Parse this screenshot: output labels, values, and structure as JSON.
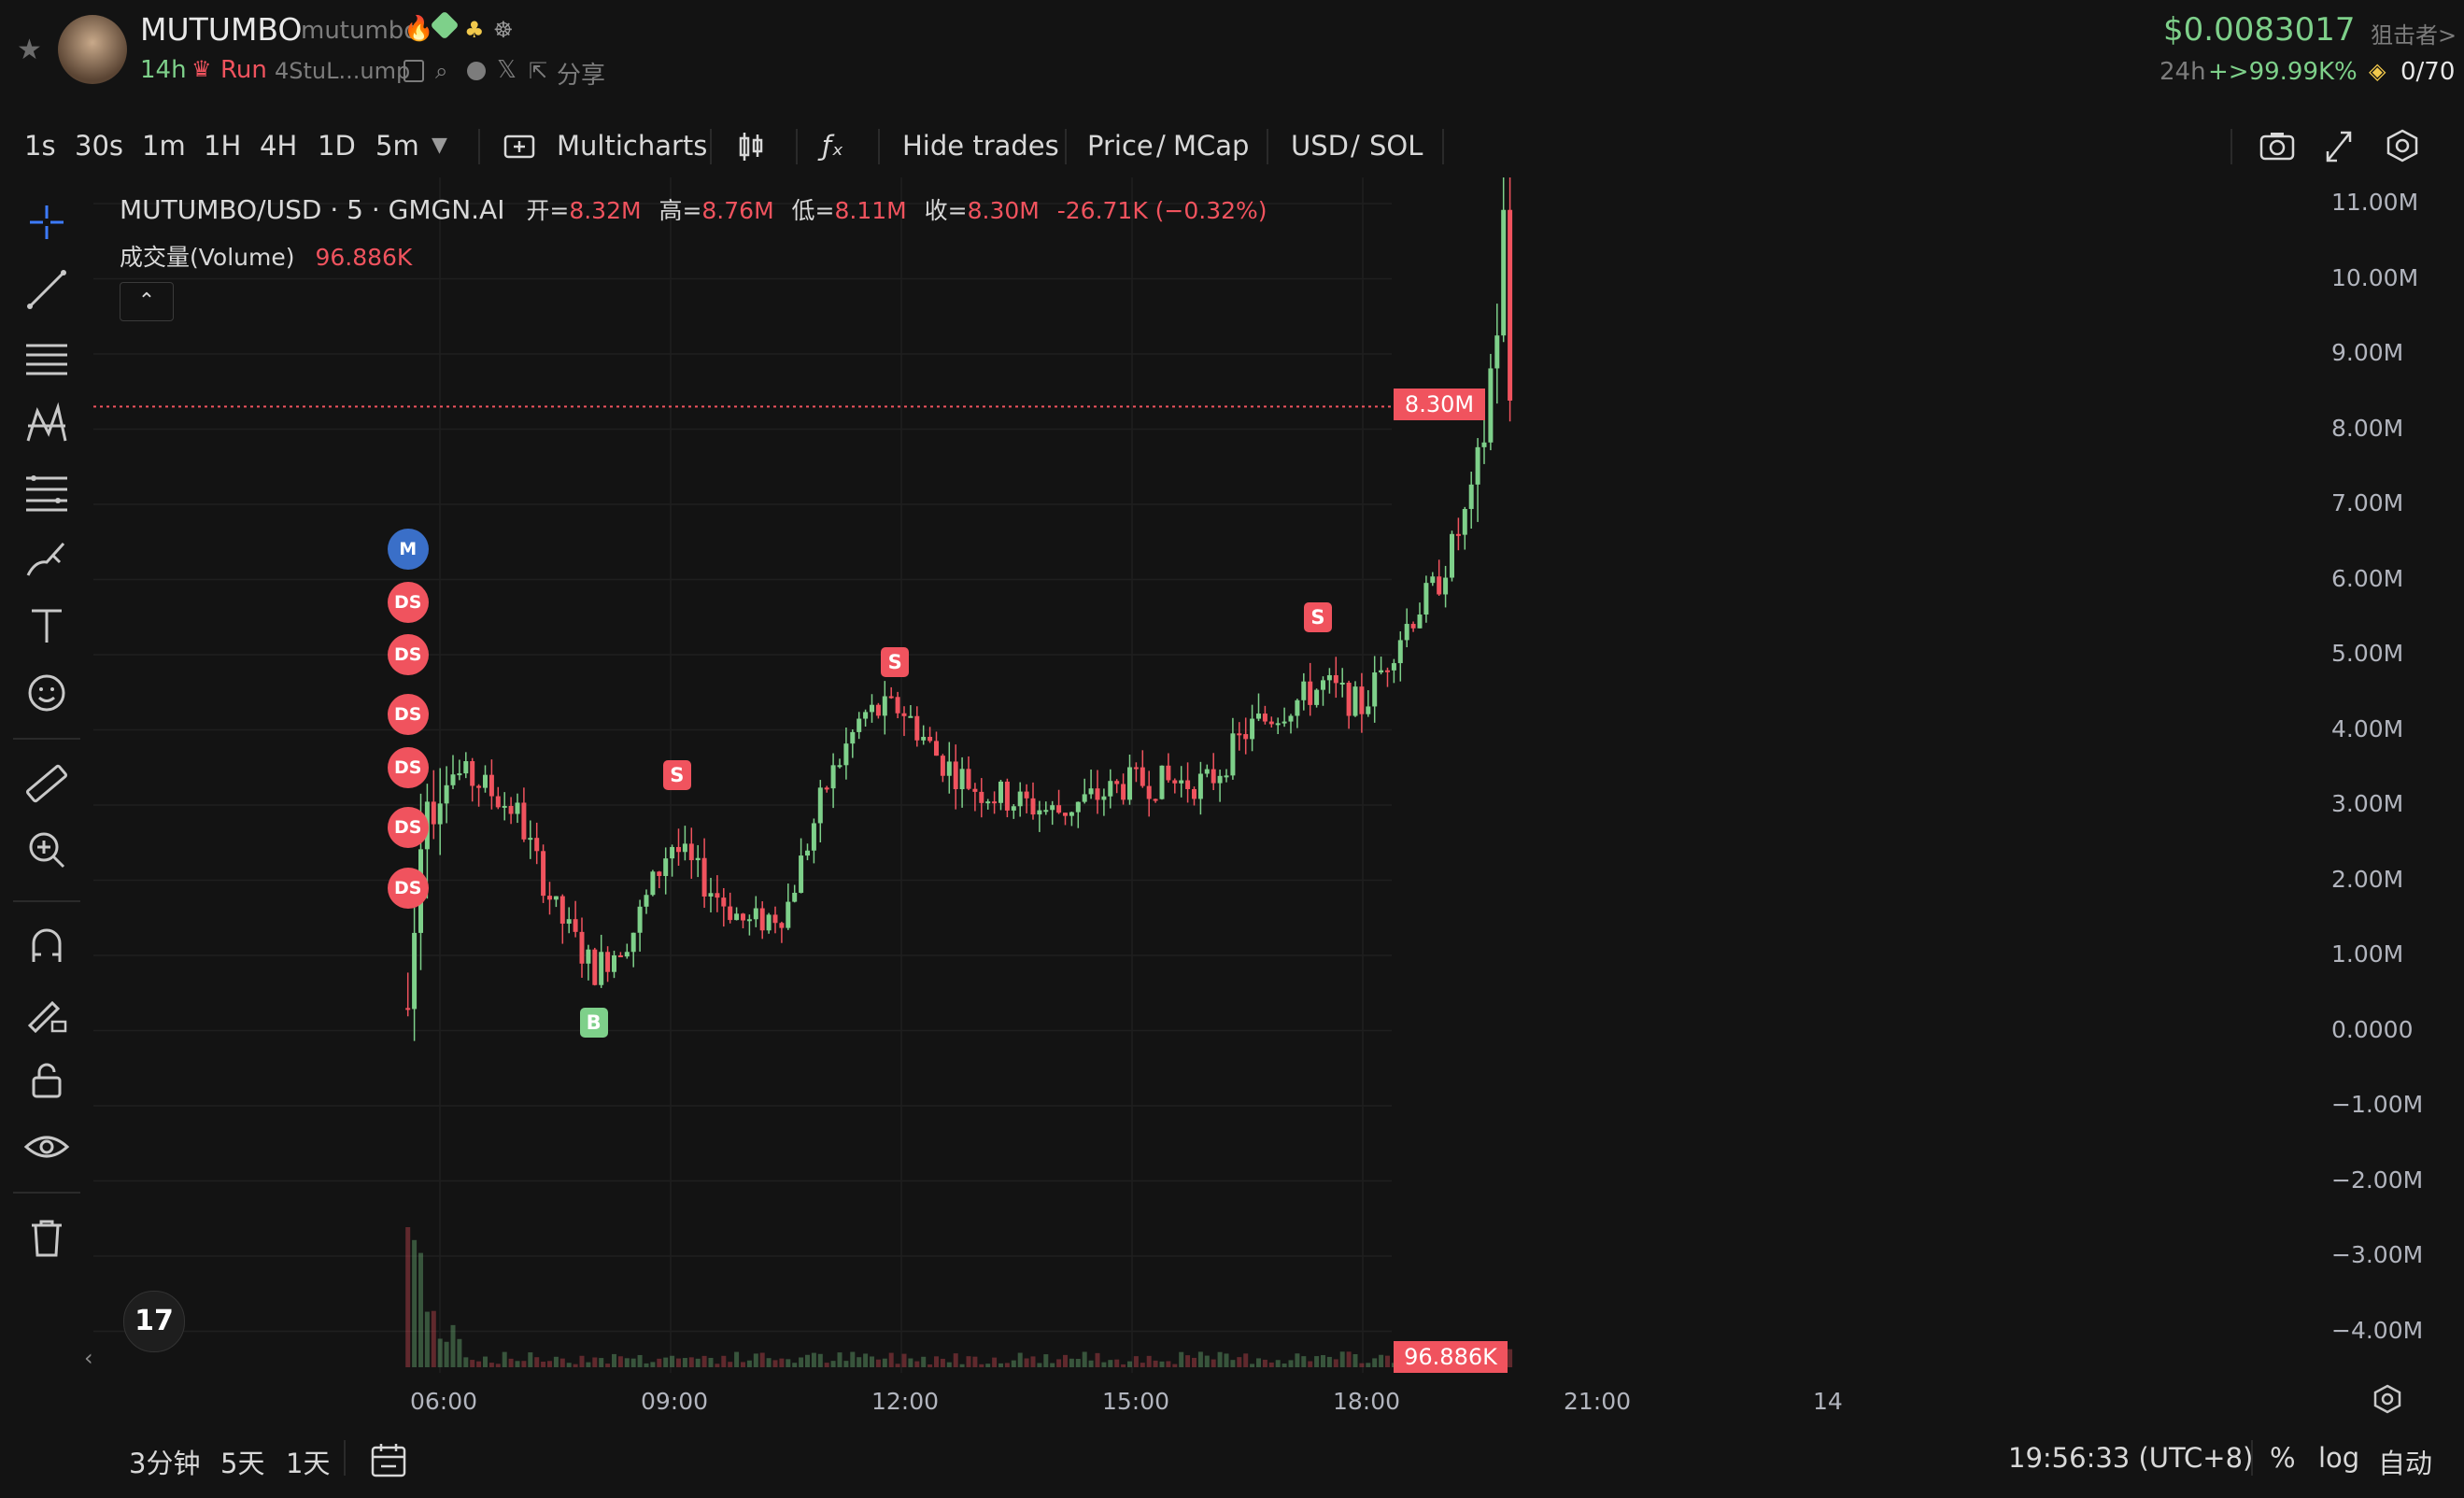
{
  "header": {
    "token_name": "MUTUMBO",
    "token_handle": "mutumbo",
    "age": "14h",
    "run_label": "Run",
    "address": "4StuL...ump",
    "share_label": "分享",
    "price": "$0.0083017",
    "sniper_label": "狙击者>",
    "change_period": "24h",
    "change_value": "+>99.99K%",
    "counter": "0/70"
  },
  "toolbar": {
    "timeframes": [
      "1s",
      "30s",
      "1m",
      "1H",
      "4H",
      "1D",
      "5m"
    ],
    "active_timeframe": "5m",
    "multicharts_label": "Multicharts",
    "hide_trades_label": "Hide trades",
    "price_label": "Price",
    "mcap_label": "MCap",
    "usd_label": "USD",
    "sol_label": "SOL",
    "slash": "/"
  },
  "legend": {
    "symbol": "MUTUMBO/USD · 5 · GMGN.AI",
    "open_label": "开=",
    "open": "8.32M",
    "high_label": "高=",
    "high": "8.76M",
    "low_label": "低=",
    "low": "8.11M",
    "close_label": "收=",
    "close": "8.30M",
    "change": "-26.71K (−0.32%)",
    "volume_label": "成交量(Volume)",
    "volume": "96.886K"
  },
  "chart_data": {
    "type": "candlestick",
    "title": "MUTUMBO/USD · 5 · GMGN.AI",
    "y_unit": "M",
    "ylim": [
      -4.5,
      11.5
    ],
    "y_ticks": [
      "11.00M",
      "10.00M",
      "9.00M",
      "8.00M",
      "7.00M",
      "6.00M",
      "5.00M",
      "4.00M",
      "3.00M",
      "2.00M",
      "1.00M",
      "0.0000",
      "−1.00M",
      "−2.00M",
      "−3.00M",
      "−4.00M"
    ],
    "x_ticks": [
      "06:00",
      "09:00",
      "12:00",
      "15:00",
      "18:00",
      "21:00",
      "14"
    ],
    "current_price_label": "8.30M",
    "current_price": 8.3,
    "volume_label": "96.886K",
    "grid": true,
    "trend_points": [
      {
        "t": "05:35",
        "v": 0.3
      },
      {
        "t": "05:45",
        "v": 3.0
      },
      {
        "t": "06:00",
        "v": 3.5
      },
      {
        "t": "06:30",
        "v": 3.3
      },
      {
        "t": "07:00",
        "v": 2.9
      },
      {
        "t": "07:30",
        "v": 1.6
      },
      {
        "t": "08:00",
        "v": 0.8
      },
      {
        "t": "08:30",
        "v": 1.3
      },
      {
        "t": "09:00",
        "v": 2.5
      },
      {
        "t": "09:30",
        "v": 1.9
      },
      {
        "t": "10:00",
        "v": 1.4
      },
      {
        "t": "10:30",
        "v": 1.6
      },
      {
        "t": "11:00",
        "v": 3.2
      },
      {
        "t": "11:30",
        "v": 4.2
      },
      {
        "t": "12:00",
        "v": 4.3
      },
      {
        "t": "12:30",
        "v": 3.6
      },
      {
        "t": "13:00",
        "v": 3.2
      },
      {
        "t": "14:00",
        "v": 2.9
      },
      {
        "t": "15:00",
        "v": 3.3
      },
      {
        "t": "16:00",
        "v": 3.3
      },
      {
        "t": "16:30",
        "v": 4.0
      },
      {
        "t": "17:30",
        "v": 4.6
      },
      {
        "t": "18:00",
        "v": 4.3
      },
      {
        "t": "18:30",
        "v": 5.3
      },
      {
        "t": "19:00",
        "v": 6.0
      },
      {
        "t": "19:30",
        "v": 7.3
      },
      {
        "t": "19:45",
        "v": 9.5
      },
      {
        "t": "19:50",
        "v": 10.7
      },
      {
        "t": "19:55",
        "v": 8.3
      }
    ],
    "trade_markers": [
      {
        "label": "M",
        "t": "05:35",
        "v": 6.4
      },
      {
        "label": "DS",
        "t": "05:35",
        "v": 5.7
      },
      {
        "label": "DS",
        "t": "05:35",
        "v": 5.0
      },
      {
        "label": "DS",
        "t": "05:35",
        "v": 4.2
      },
      {
        "label": "DS",
        "t": "05:35",
        "v": 3.5
      },
      {
        "label": "DS",
        "t": "05:35",
        "v": 2.7
      },
      {
        "label": "DS",
        "t": "05:35",
        "v": 1.9
      },
      {
        "label": "S",
        "t": "09:05",
        "v": 3.4
      },
      {
        "label": "B",
        "t": "08:00",
        "v": 0.1
      },
      {
        "label": "S",
        "t": "11:55",
        "v": 4.9
      },
      {
        "label": "S",
        "t": "17:25",
        "v": 5.5
      }
    ]
  },
  "bottom": {
    "ranges": [
      "3分钟",
      "5天",
      "1天"
    ],
    "clock": "19:56:33 (UTC+8)",
    "percent": "%",
    "log": "log",
    "auto": "自动"
  },
  "colors": {
    "up": "#7ed08a",
    "down": "#f0535e",
    "accent": "#3d7bff",
    "background": "#131313",
    "grid": "#1f1f1f"
  }
}
